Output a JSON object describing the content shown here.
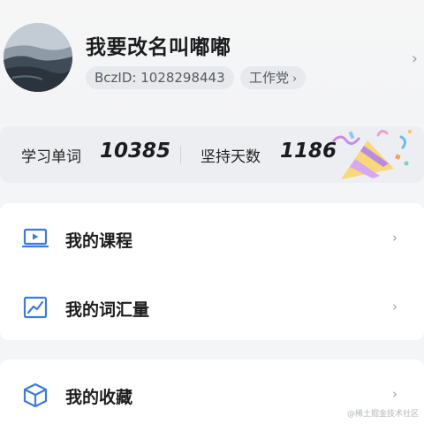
{
  "profile": {
    "username": "我要改名叫嘟嘟",
    "bcz_id": "BczID: 1028298443",
    "team_label": "工作党",
    "team_arrow": "›",
    "arrow": "›"
  },
  "stats": {
    "words_label": "学习单词",
    "words_value": "10385",
    "days_label": "坚持天数",
    "days_value": "1186"
  },
  "menu": {
    "courses": {
      "label": "我的课程",
      "icon": "laptop-play-icon"
    },
    "vocabulary": {
      "label": "我的词汇量",
      "icon": "trend-chart-icon"
    },
    "favorites": {
      "label": "我的收藏",
      "icon": "cube-icon"
    },
    "chevron": "›"
  },
  "watermark": "@稀土掘金技术社区",
  "colors": {
    "icon_blue": "#3d7bd9",
    "page_bg": "#f4f5f7",
    "chip_bg": "#e8e9ec"
  }
}
